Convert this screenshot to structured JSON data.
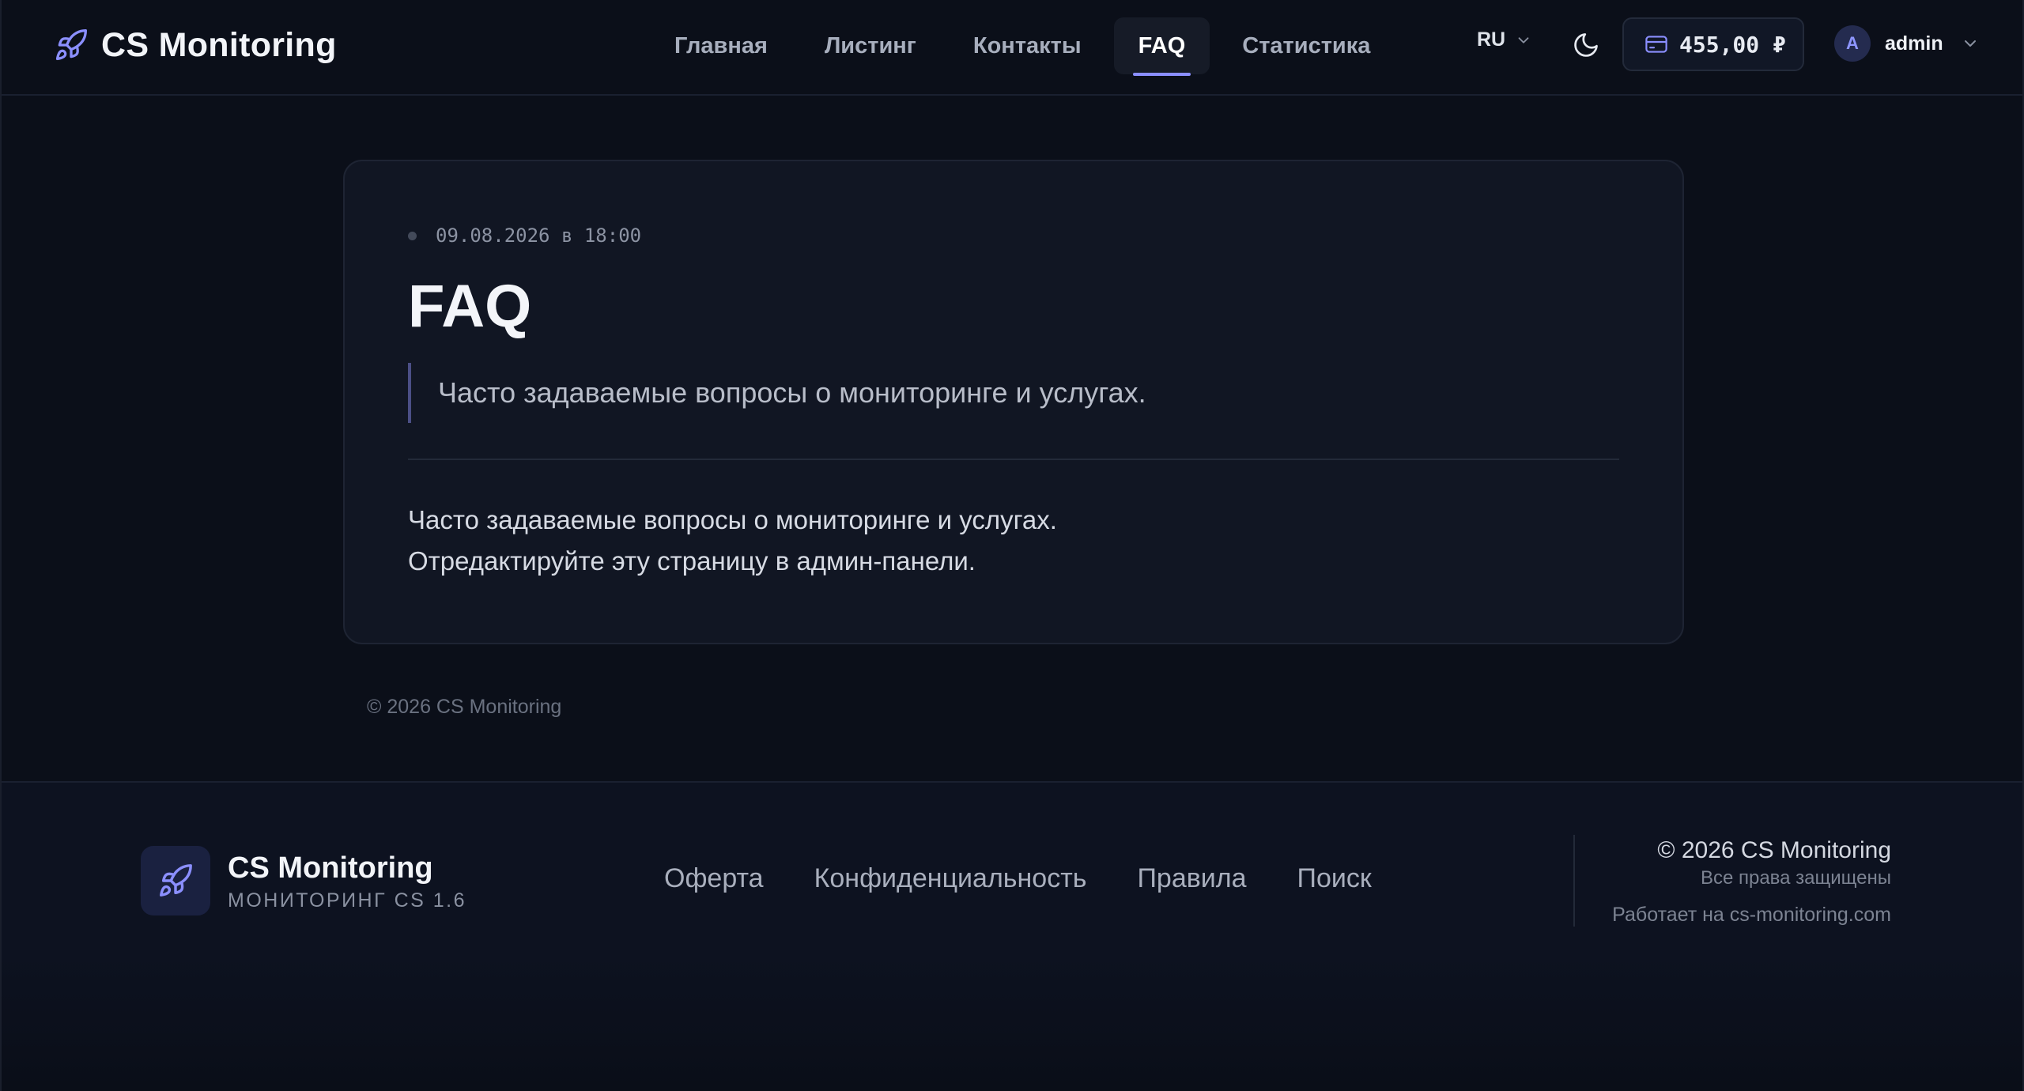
{
  "header": {
    "brand": "CS Monitoring",
    "nav": [
      {
        "label": "Главная"
      },
      {
        "label": "Листинг"
      },
      {
        "label": "Контакты"
      },
      {
        "label": "FAQ",
        "active": true
      },
      {
        "label": "Статистика"
      }
    ],
    "lang": "RU",
    "balance": "455,00 ₽",
    "user": {
      "initial": "A",
      "name": "admin"
    }
  },
  "article": {
    "date": "09.08.2026 в 18:00",
    "title": "FAQ",
    "lead": "Часто задаваемые вопросы о мониторинге и услугах.",
    "body_line1": "Часто задаваемые вопросы о мониторинге и услугах.",
    "body_line2": "Отредактируйте эту страницу в админ-панели."
  },
  "page_copyright": "© 2026 CS Monitoring",
  "footer": {
    "brand": "CS Monitoring",
    "subtitle": "МОНИТОРИНГ CS 1.6",
    "links": [
      "Оферта",
      "Конфиденциальность",
      "Правила",
      "Поиск"
    ],
    "copyright": "© 2026 CS Monitoring",
    "rights": "Все права защищены",
    "powered": "Работает на cs-monitoring.com"
  },
  "colors": {
    "background": "#0b0f19",
    "card": "#111623",
    "accent": "#8b8fff",
    "text": "#e6e9f0",
    "muted": "#7c8392"
  },
  "icons": {
    "brand": "rocket-icon",
    "lang": "chevron-down-icon",
    "theme": "moon-icon",
    "balance": "credit-card-icon",
    "user_menu": "chevron-down-icon"
  }
}
